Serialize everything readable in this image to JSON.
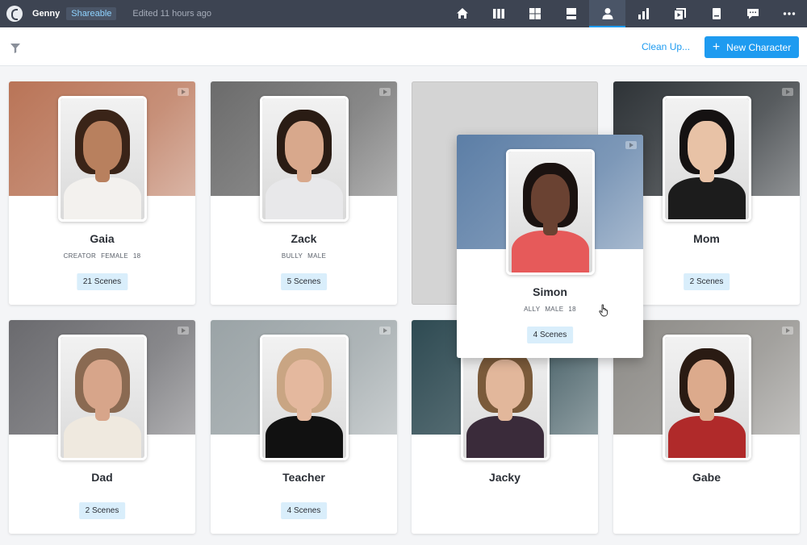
{
  "header": {
    "project_name": "Genny",
    "share_badge": "Shareable",
    "edited": "Edited 11 hours ago",
    "nav": [
      {
        "name": "home-icon"
      },
      {
        "name": "columns-icon"
      },
      {
        "name": "grid-icon"
      },
      {
        "name": "layout-icon"
      },
      {
        "name": "person-icon",
        "active": true
      },
      {
        "name": "bar-chart-icon"
      },
      {
        "name": "media-icon"
      },
      {
        "name": "book-icon"
      },
      {
        "name": "comment-icon"
      },
      {
        "name": "more-icon"
      }
    ]
  },
  "toolbar": {
    "cleanup_label": "Clean Up...",
    "new_label": "New Character",
    "new_plus": "+"
  },
  "colors": {
    "accent": "#1e9bf0",
    "topbar": "#3d4452",
    "scene_badge": "#d9eefb"
  },
  "characters": [
    {
      "name": "Gaia",
      "tags": [
        "CREATOR",
        "FEMALE",
        "18"
      ],
      "scenes": "21 Scenes",
      "bg": "#b97457",
      "skin": "#b8805e",
      "hair": "#3a2418",
      "body": "#f3f1ee"
    },
    {
      "name": "Zack",
      "tags": [
        "BULLY",
        "MALE"
      ],
      "scenes": "5 Scenes",
      "bg": "#6b6b6b",
      "skin": "#d8a88c",
      "hair": "#2a1c14",
      "body": "#e8e8ea"
    },
    {
      "name": "Simon",
      "tags": [
        "ALLY",
        "MALE",
        "18"
      ],
      "scenes": "4 Scenes",
      "bg": "#5c7ea6",
      "skin": "#6a4232",
      "hair": "#1a1210",
      "body": "#e65a5a"
    },
    {
      "name": "Mom",
      "tags": [],
      "scenes": "2 Scenes",
      "bg": "#2e3337",
      "skin": "#e8c2a6",
      "hair": "#151212",
      "body": "#1c1c1c"
    },
    {
      "name": "Dad",
      "tags": [],
      "scenes": "2 Scenes",
      "bg": "#6a6a6e",
      "skin": "#d7a58a",
      "hair": "#8a6a52",
      "body": "#efe9df"
    },
    {
      "name": "Teacher",
      "tags": [],
      "scenes": "4 Scenes",
      "bg": "#9aa3a6",
      "skin": "#e4b89e",
      "hair": "#c9a583",
      "body": "#111111"
    },
    {
      "name": "Jacky",
      "tags": [],
      "scenes": "",
      "bg": "#2e4a52",
      "skin": "#e2b79b",
      "hair": "#7a5a3a",
      "body": "#3a2b3a"
    },
    {
      "name": "Gabe",
      "tags": [],
      "scenes": "",
      "bg": "#8c8a86",
      "skin": "#dcaa8c",
      "hair": "#2a1b13",
      "body": "#b02a2a"
    }
  ]
}
